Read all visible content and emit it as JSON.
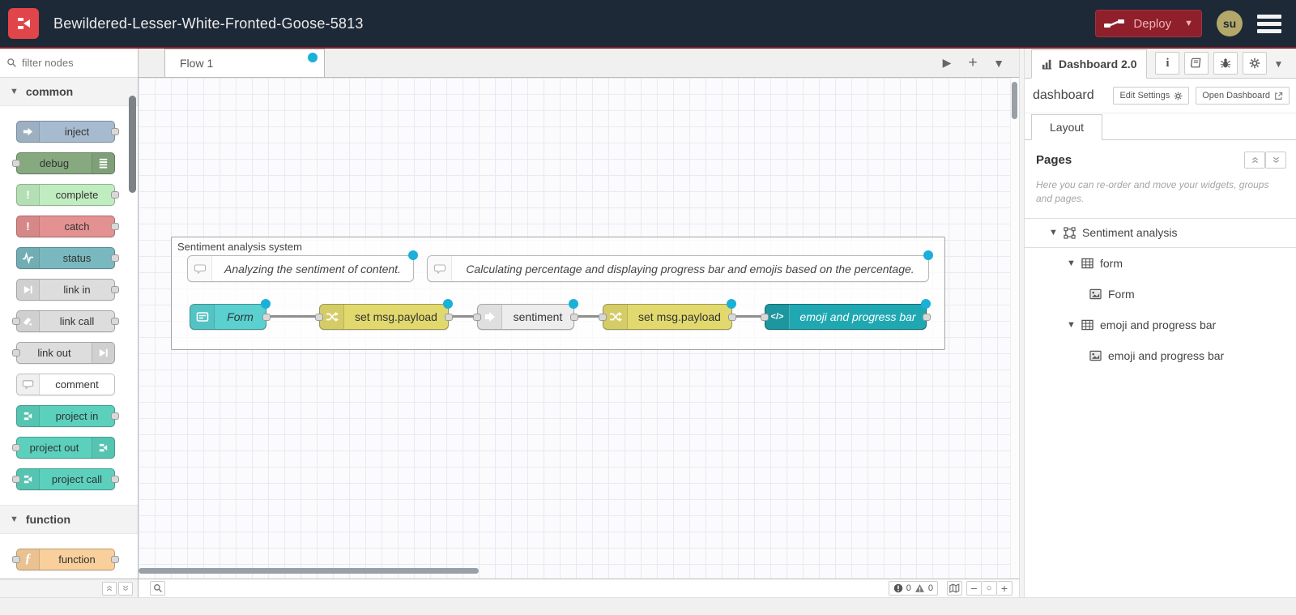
{
  "header": {
    "title": "Bewildered-Lesser-White-Fronted-Goose-5813",
    "deploy_label": "Deploy",
    "avatar": "su"
  },
  "palette": {
    "search_placeholder": "filter nodes",
    "categories": [
      {
        "label": "common",
        "nodes": [
          {
            "label": "inject"
          },
          {
            "label": "debug"
          },
          {
            "label": "complete"
          },
          {
            "label": "catch"
          },
          {
            "label": "status"
          },
          {
            "label": "link in"
          },
          {
            "label": "link call"
          },
          {
            "label": "link out"
          },
          {
            "label": "comment"
          },
          {
            "label": "project in"
          },
          {
            "label": "project out"
          },
          {
            "label": "project call"
          }
        ]
      },
      {
        "label": "function",
        "nodes": [
          {
            "label": "function"
          }
        ]
      }
    ]
  },
  "workspace": {
    "tab_label": "Flow 1",
    "group_label": "Sentiment analysis system",
    "comment1": "Analyzing the sentiment of content.",
    "comment2": "Calculating percentage and displaying progress bar and emojis based on the percentage.",
    "node_form": "Form",
    "node_change1": "set msg.payload",
    "node_sentiment": "sentiment",
    "node_change2": "set msg.payload",
    "node_template": "emoji and progress bar",
    "footer": {
      "errors": "0",
      "warnings": "0"
    }
  },
  "sidebar": {
    "tab_label": "Dashboard 2.0",
    "title": "dashboard",
    "edit_settings_label": "Edit Settings",
    "open_dashboard_label": "Open Dashboard",
    "layout_tab_label": "Layout",
    "pages_title": "Pages",
    "hint": "Here you can re-order and move your widgets, groups and pages.",
    "tree": {
      "page_label": "Sentiment analysis",
      "group1_label": "form",
      "widget1_label": "Form",
      "group2_label": "emoji and progress bar",
      "widget2_label": "emoji and progress bar"
    }
  },
  "colors": {
    "header_bg": "#1E2937",
    "accent_red": "#8C1D2C",
    "deploy_red": "#8E1F2B",
    "changed_dot": "#1AB0D8",
    "node_inject": "#A6BBCF",
    "node_debug": "#87A980",
    "node_complete": "#C0EDC0",
    "node_catch": "#E49191",
    "node_status": "#79B8BF",
    "node_link": "#DDDDDD",
    "node_comment": "#FFFFFF",
    "node_project": "#5BD1BD",
    "node_function": "#F9CF9B",
    "node_form": "#5AD0D0",
    "node_change": "#E2D96E",
    "node_sentiment": "#EDEDED",
    "node_template": "#20A8B2"
  }
}
